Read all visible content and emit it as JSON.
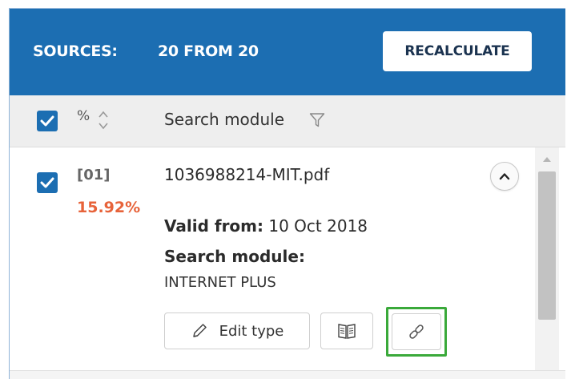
{
  "header": {
    "sources_label": "SOURCES:",
    "count_text": "20 FROM 20",
    "recalculate_label": "RECALCULATE"
  },
  "columns": {
    "percent_label": "%",
    "search_module_label": "Search module"
  },
  "source_item": {
    "index": "[01]",
    "percent": "15.92%",
    "filename": "1036988214-MIT.pdf",
    "valid_from_label": "Valid from:",
    "valid_from_value": "10 Oct 2018",
    "search_module_label": "Search module:",
    "search_module_value": "INTERNET PLUS",
    "edit_type_label": "Edit type"
  },
  "colors": {
    "header_bg": "#1c6eb2",
    "percent_color": "#e7633a",
    "highlight_border": "#3aa93a"
  }
}
